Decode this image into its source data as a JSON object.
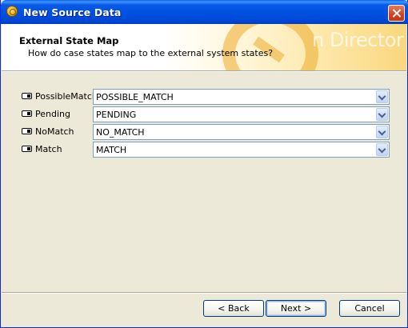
{
  "window": {
    "title": "New Source Data"
  },
  "header": {
    "title": "External State Map",
    "subtitle": "How do case states map to the external system states?",
    "banner_text": "n Director"
  },
  "mappings": [
    {
      "label": "PossibleMatch",
      "value": "POSSIBLE_MATCH"
    },
    {
      "label": "Pending",
      "value": "PENDING"
    },
    {
      "label": "NoMatch",
      "value": "NO_MATCH"
    },
    {
      "label": "Match",
      "value": "MATCH"
    }
  ],
  "buttons": {
    "back": "< Back",
    "next": "Next >",
    "cancel": "Cancel"
  },
  "colors": {
    "titlebar": "#0050E0",
    "dialog_bg": "#ECE9D8",
    "combo_border": "#7F9DB9"
  },
  "icons": {
    "app": "app-logo-icon",
    "close": "close-icon",
    "state": "state-toggle-icon",
    "dropdown": "chevron-down-icon"
  }
}
